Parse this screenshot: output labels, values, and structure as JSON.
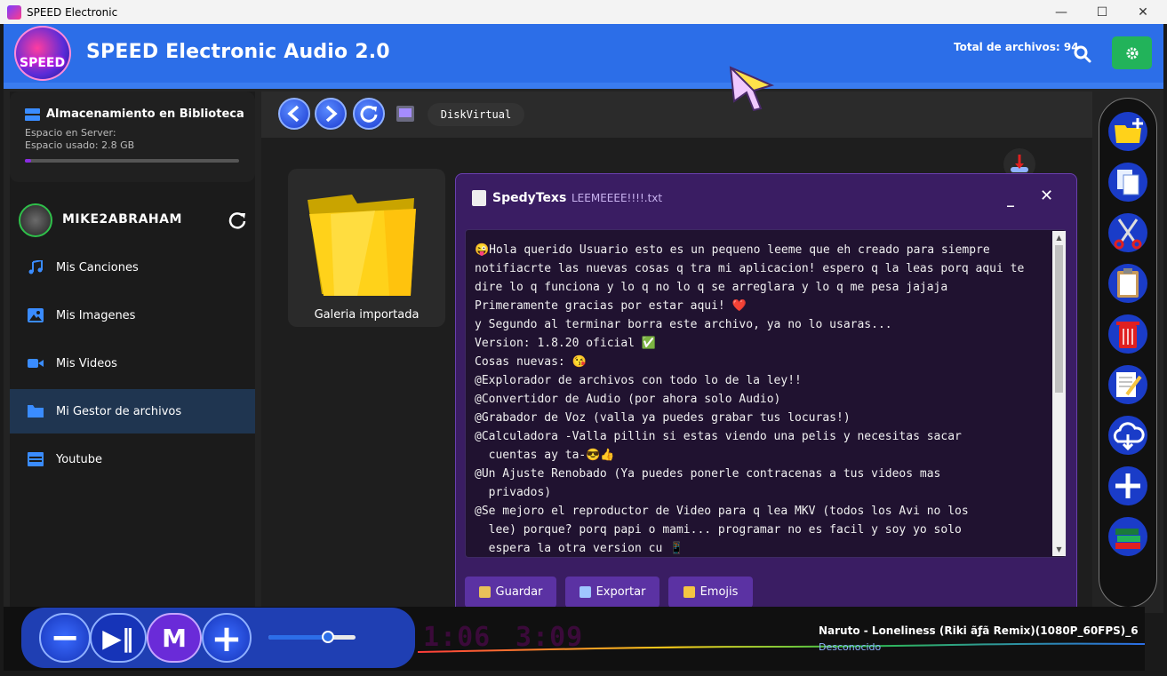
{
  "window": {
    "title": "SPEED Electronic",
    "minimize": "—",
    "maximize": "☐",
    "close": "✕"
  },
  "header": {
    "logo_text": "SPEED",
    "title": "SPEED Electronic Audio 2.0",
    "file_count": "Total de archivos: 94"
  },
  "storage": {
    "title": "Almacenamiento en Biblioteca",
    "server_label": "Espacio en Server:",
    "used_label": "Espacio usado: 2.8 GB",
    "usage_fraction": 0.03
  },
  "user": {
    "name": "MIKE2ABRAHAM"
  },
  "nav": [
    {
      "label": "Mis Canciones",
      "icon": "music-note-icon"
    },
    {
      "label": "Mis Imagenes",
      "icon": "image-icon"
    },
    {
      "label": "Mis Videos",
      "icon": "video-camera-icon"
    },
    {
      "label": "Mi Gestor de archivos",
      "icon": "folder-icon",
      "active": true
    },
    {
      "label": "Youtube",
      "icon": "youtube-icon"
    }
  ],
  "toolbar": {
    "path_chip": "DiskVirtual"
  },
  "folder": {
    "label": "Galeria importada"
  },
  "editor": {
    "app": "SpedyTexs",
    "file": "LEEMEEEE!!!!.txt",
    "minimize": "_",
    "close": "✕",
    "lines": [
      "😜Hola querido Usuario esto es un pequeno leeme que eh creado para siempre",
      "notifiacrte las nuevas cosas q tra mi aplicacion! espero q la leas porq aqui te",
      "dire lo q funciona y lo q no lo q se arreglara y lo q me pesa jajaja",
      "Primeramente gracias por estar aqui! ❤️",
      "y Segundo al terminar borra este archivo, ya no lo usaras...",
      "Version: 1.8.20 oficial ✅",
      "Cosas nuevas: 😘",
      "@Explorador de archivos con todo lo de la ley!!",
      "@Convertidor de Audio (por ahora solo Audio)",
      "@Grabador de Voz (valla ya puedes grabar tus locuras!)",
      "@Calculadora -Valla pillin si estas viendo una pelis y necesitas sacar",
      "  cuentas ay ta-😎👍",
      "@Un Ajuste Renobado (Ya puedes ponerle contracenas a tus videos mas",
      "  privados)",
      "@Se mejoro el reproductor de Video para q lea MKV (todos los Avi no los",
      "  lee) porque? porq papi o mami... programar no es facil y soy yo solo",
      "  espera la otra version cu 📱"
    ],
    "buttons": {
      "save": "Guardar",
      "export": "Exportar",
      "emojis": "Emojis"
    }
  },
  "right_tools": [
    "new-folder-icon",
    "copy-icon",
    "cut-icon",
    "paste-icon",
    "delete-icon",
    "edit-icon",
    "cloud-download-icon",
    "add-icon",
    "library-books-icon"
  ],
  "player": {
    "minus": "−",
    "playpause": "▶‖",
    "mode": "M",
    "plus": "+",
    "volume_fraction": 0.68,
    "elapsed": "1:06",
    "duration": "3:09",
    "song": "Naruto - Loneliness (Riki ãƒã Remix)(1080P_60FPS)_6",
    "artist": "Desconocido"
  },
  "colors": {
    "header": "#2c6ee8",
    "accent_purple": "#5b32a3",
    "active_nav": "#1f3550",
    "settings_green": "#22b35a"
  }
}
